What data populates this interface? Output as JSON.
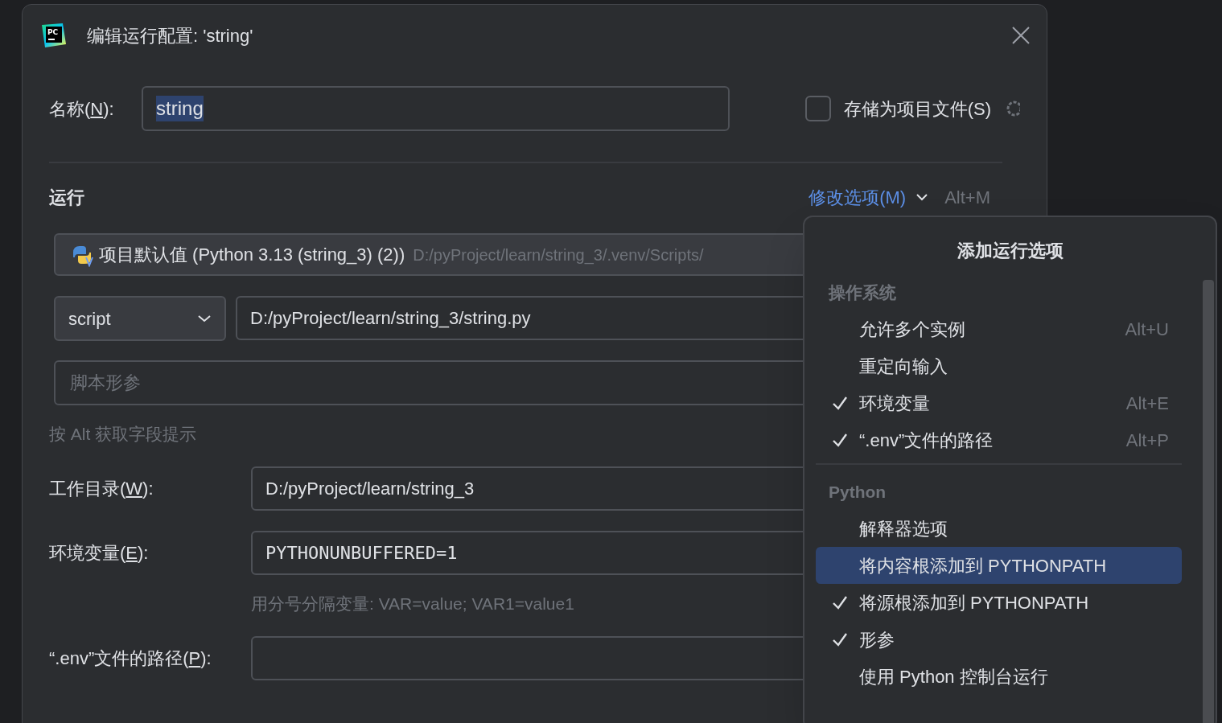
{
  "window": {
    "logo_text": "PC",
    "title": "编辑运行配置: 'string'"
  },
  "name_field": {
    "label": {
      "prefix": "名称(",
      "mnemonic": "N",
      "suffix": "):"
    },
    "value": "string"
  },
  "store_checkbox": {
    "label": "存储为项目文件(S)",
    "checked": false
  },
  "run_section": {
    "title": "运行",
    "modify_link": "修改选项(M)",
    "shortcut": "Alt+M"
  },
  "interpreter": {
    "name": "项目默认值 (Python 3.13 (string_3) (2))",
    "path": "D:/pyProject/learn/string_3/.venv/Scripts/"
  },
  "target_type": {
    "value": "script"
  },
  "script_path": {
    "value": "D:/pyProject/learn/string_3/string.py"
  },
  "script_params": {
    "placeholder": "脚本形参"
  },
  "alt_hint": "按 Alt 获取字段提示",
  "fields": [
    {
      "label": {
        "prefix": "工作目录(",
        "mnemonic": "W",
        "suffix": "):"
      },
      "value": "D:/pyProject/learn/string_3",
      "kind": "text"
    },
    {
      "label": {
        "prefix": "环境变量(",
        "mnemonic": "E",
        "suffix": "):"
      },
      "value": "PYTHONUNBUFFERED=1",
      "kind": "mono",
      "hint": "用分号分隔变量: VAR=value; VAR1=value1"
    },
    {
      "label": {
        "prefix": "“.env”文件的路径(",
        "mnemonic": "P",
        "suffix": "):"
      },
      "kind": "text"
    }
  ],
  "popup": {
    "title": "添加运行选项",
    "groups": [
      {
        "heading": "操作系统",
        "items": [
          {
            "label": "允许多个实例",
            "shortcut": "Alt+U",
            "checked": false,
            "selected": false
          },
          {
            "label": "重定向输入",
            "checked": false,
            "selected": false
          },
          {
            "label": "环境变量",
            "shortcut": "Alt+E",
            "checked": true,
            "selected": false
          },
          {
            "label": "“.env”文件的路径",
            "shortcut": "Alt+P",
            "checked": true,
            "selected": false
          }
        ]
      },
      {
        "heading": "Python",
        "items": [
          {
            "label": "解释器选项",
            "checked": false,
            "selected": false
          },
          {
            "label": "将内容根添加到 PYTHONPATH",
            "checked": false,
            "selected": true
          },
          {
            "label": "将源根添加到 PYTHONPATH",
            "checked": true,
            "selected": false
          },
          {
            "label": "形参",
            "checked": true,
            "selected": false
          },
          {
            "label": "使用 Python 控制台运行",
            "checked": false,
            "selected": false
          }
        ]
      }
    ]
  }
}
